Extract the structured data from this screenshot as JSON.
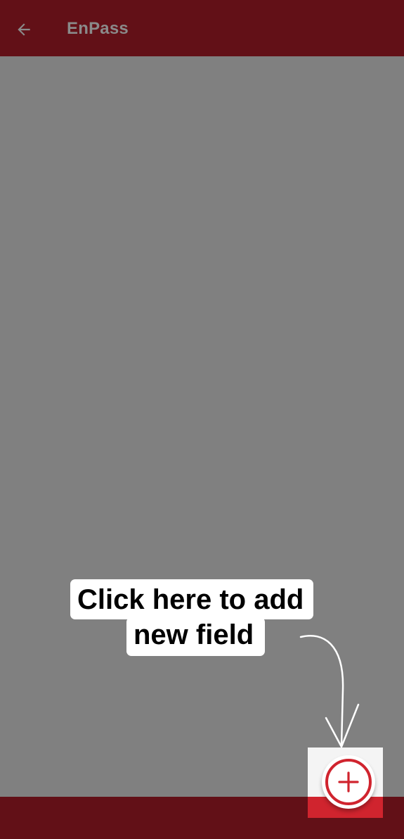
{
  "app_bar": {
    "title": "EnPass",
    "back_icon": "arrow-left-icon"
  },
  "coach_mark": {
    "line1": "Click here to add",
    "line2": "new field",
    "pointer_icon": "curved-arrow-down-icon"
  },
  "fab": {
    "icon": "plus-icon"
  },
  "colors": {
    "app_bar": "#621017",
    "scrim": "#808080",
    "accent": "#d0242e",
    "title_text": "#8a8a8a"
  }
}
